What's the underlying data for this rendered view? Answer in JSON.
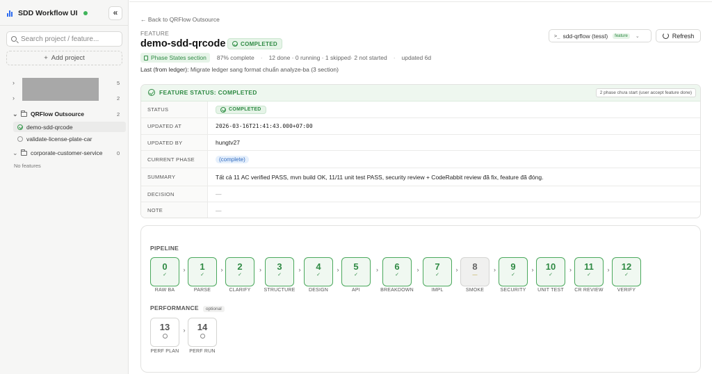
{
  "sidebar": {
    "app_title": "SDD Workflow UI",
    "collapse_glyph": "«",
    "search_placeholder": "Search project / feature...",
    "add_project_label": "Add project",
    "projects": [
      {
        "name": "",
        "count": "5",
        "redacted": true
      },
      {
        "name": "",
        "count": "2",
        "redacted": true
      },
      {
        "name": "QRFlow Outsource",
        "count": "2"
      },
      {
        "name": "corporate-customer-service",
        "count": "0"
      }
    ],
    "features": [
      {
        "name": "demo-sdd-qrcode",
        "status": "completed",
        "active": true
      },
      {
        "name": "validate-license-plate-car",
        "status": "not-started",
        "active": false
      }
    ],
    "no_features_text": "No features"
  },
  "header": {
    "back_link": "← Back to QRFlow Outsource",
    "feature_label": "FEATURE",
    "feature_name": "demo-sdd-qrcode",
    "status_badge": "COMPLETED",
    "phase_states_link": "Phase States section",
    "percent_complete": "87% complete",
    "progress_summary": "12 done · 0 running · 1 skipped· 2 not started",
    "updated": "updated 6d",
    "ledger_label": "Last (from ledger):",
    "ledger_text": "Migrate ledger sang format chuẩn analyze-ba (3 section)",
    "command_select": "sdd-qrflow (tessl)",
    "command_tag": "feature",
    "refresh_label": "Refresh"
  },
  "status_card": {
    "title": "FEATURE STATUS: COMPLETED",
    "note": "2 phase chưa start (user accept feature done)",
    "rows": [
      {
        "key": "STATUS",
        "value": "COMPLETED"
      },
      {
        "key": "UPDATED AT",
        "value": "2026-03-16T21:41:43.000+07:00"
      },
      {
        "key": "UPDATED BY",
        "value": "hungtv27"
      },
      {
        "key": "CURRENT PHASE",
        "value": "(complete)"
      },
      {
        "key": "SUMMARY",
        "value": "Tất cả 11 AC verified PASS, mvn build OK, 11/11 unit test PASS, security review + CodeRabbit review đã fix, feature đã đóng."
      },
      {
        "key": "DECISION",
        "value": "—"
      },
      {
        "key": "NOTE",
        "value": "—"
      }
    ]
  },
  "pipeline": {
    "label": "PIPELINE",
    "steps": [
      {
        "num": "0",
        "label": "RAW BA",
        "state": "done"
      },
      {
        "num": "1",
        "label": "PARSE",
        "state": "done"
      },
      {
        "num": "2",
        "label": "CLARIFY",
        "state": "done"
      },
      {
        "num": "3",
        "label": "STRUCTURE",
        "state": "done"
      },
      {
        "num": "4",
        "label": "DESIGN",
        "state": "done"
      },
      {
        "num": "5",
        "label": "API",
        "state": "done"
      },
      {
        "num": "6",
        "label": "BREAKDOWN",
        "state": "done"
      },
      {
        "num": "7",
        "label": "IMPL",
        "state": "done"
      },
      {
        "num": "8",
        "label": "SMOKE",
        "state": "skipped"
      },
      {
        "num": "9",
        "label": "SECURITY",
        "state": "done"
      },
      {
        "num": "10",
        "label": "UNIT TEST",
        "state": "done"
      },
      {
        "num": "11",
        "label": "CR REVIEW",
        "state": "done"
      },
      {
        "num": "12",
        "label": "VERIFY",
        "state": "done"
      }
    ]
  },
  "performance": {
    "label": "PERFORMANCE",
    "optional_tag": "optional",
    "steps": [
      {
        "num": "13",
        "label": "PERF PLAN",
        "state": "pending"
      },
      {
        "num": "14",
        "label": "PERF RUN",
        "state": "pending"
      }
    ]
  },
  "colors": {
    "accent_green": "#2e8a43",
    "link_blue": "#2f6ac0",
    "online": "#3fb45a"
  },
  "icons": [
    "bar-chart-icon",
    "chevron-double-left-icon",
    "search-icon",
    "plus-icon",
    "chevron-right-icon",
    "chevron-down-icon",
    "folder-icon",
    "check-circle-icon",
    "circle-icon",
    "terminal-icon",
    "refresh-icon",
    "document-icon",
    "check-icon",
    "minus-icon",
    "arrow-right-icon"
  ]
}
